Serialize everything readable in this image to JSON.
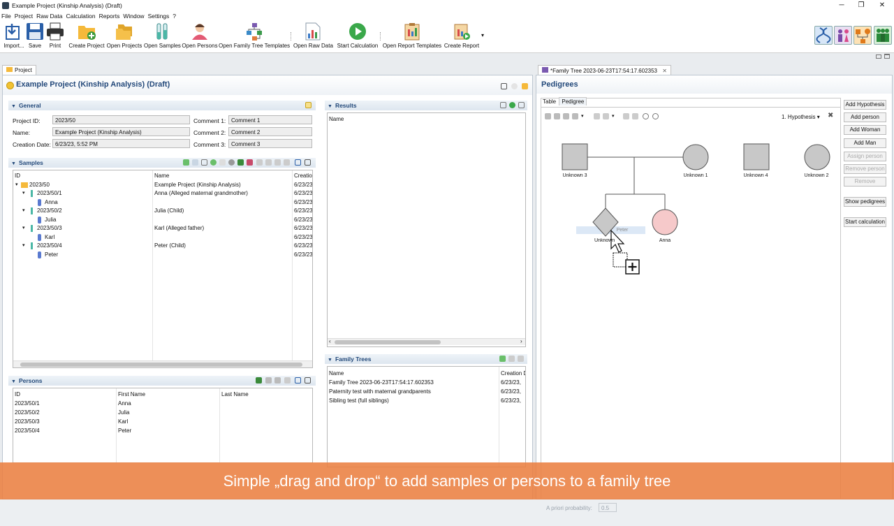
{
  "window": {
    "title": "Example Project (Kinship Analysis) (Draft)",
    "controls": [
      "─",
      "❐",
      "✕"
    ]
  },
  "menu": [
    "File",
    "Project",
    "Raw Data",
    "Calculation",
    "Reports",
    "Window",
    "Settings",
    "?"
  ],
  "toolbar": {
    "buttons": [
      {
        "label": "Import...",
        "icon": "import-icon"
      },
      {
        "label": "Save",
        "icon": "save-icon"
      },
      {
        "label": "Print",
        "icon": "print-icon"
      },
      {
        "label": "Create Project",
        "icon": "folder-add-icon"
      },
      {
        "label": "Open Projects",
        "icon": "folder-open-icon"
      },
      {
        "label": "Open Samples",
        "icon": "test-tubes-icon"
      },
      {
        "label": "Open Persons",
        "icon": "person-icon"
      },
      {
        "label": "Open Family Tree Templates",
        "icon": "family-tree-icon"
      },
      {
        "label": "Open Raw Data",
        "icon": "raw-data-icon"
      },
      {
        "label": "Start Calculation",
        "icon": "play-icon"
      },
      {
        "label": "Open Report Templates",
        "icon": "report-template-icon"
      },
      {
        "label": "Create Report",
        "icon": "report-create-icon"
      }
    ],
    "dropdown_glyph": "▾",
    "perspectives": [
      "dna-perspective-icon",
      "persons-perspective-icon",
      "pedigree-perspective-icon",
      "family-perspective-icon"
    ]
  },
  "left_tab": {
    "label": "Project"
  },
  "project_header": {
    "title": "Example Project (Kinship Analysis) (Draft)"
  },
  "general": {
    "title": "General",
    "project_id_label": "Project ID:",
    "project_id": "2023/50",
    "name_label": "Name:",
    "name": "Example Project (Kinship Analysis)",
    "creation_label": "Creation Date:",
    "creation": "6/23/23, 5:52 PM",
    "comment1_label": "Comment 1:",
    "comment1": "Comment 1",
    "comment2_label": "Comment 2:",
    "comment2": "Comment 2",
    "comment3_label": "Comment 3:",
    "comment3": "Comment 3"
  },
  "samples": {
    "title": "Samples",
    "columns": [
      "ID",
      "Name",
      "Creation"
    ],
    "rows": [
      {
        "id": "2023/50",
        "name": "Example Project (Kinship Analysis)",
        "date": "6/23/23"
      },
      {
        "id": "2023/50/1",
        "name": "Anna (Alleged maternal grandmother)",
        "date": "6/23/23"
      },
      {
        "id": "Anna",
        "name": "",
        "date": "6/23/23"
      },
      {
        "id": "2023/50/2",
        "name": "Julia (Child)",
        "date": "6/23/23"
      },
      {
        "id": "Julia",
        "name": "",
        "date": "6/23/23"
      },
      {
        "id": "2023/50/3",
        "name": "Karl (Alleged father)",
        "date": "6/23/23"
      },
      {
        "id": "Karl",
        "name": "",
        "date": "6/23/23"
      },
      {
        "id": "2023/50/4",
        "name": "Peter (Child)",
        "date": "6/23/23"
      },
      {
        "id": "Peter",
        "name": "",
        "date": "6/23/23"
      }
    ]
  },
  "persons": {
    "title": "Persons",
    "columns": [
      "ID",
      "First Name",
      "Last Name"
    ],
    "rows": [
      {
        "id": "2023/50/1",
        "first": "Anna",
        "last": ""
      },
      {
        "id": "2023/50/2",
        "first": "Julia",
        "last": ""
      },
      {
        "id": "2023/50/3",
        "first": "Karl",
        "last": ""
      },
      {
        "id": "2023/50/4",
        "first": "Peter",
        "last": ""
      }
    ]
  },
  "results": {
    "title": "Results",
    "column": "Name"
  },
  "family_trees": {
    "title": "Family Trees",
    "columns": [
      "Name",
      "Creation D"
    ],
    "rows": [
      {
        "name": "Family Tree 2023-06-23T17:54:17.602353",
        "date": "6/23/23,"
      },
      {
        "name": "Paternity test with maternal grandparents",
        "date": "6/23/23,"
      },
      {
        "name": "Sibling test (full siblings)",
        "date": "6/23/23,"
      }
    ]
  },
  "right_tab": {
    "label": "*Family Tree 2023-06-23T17:54:17.602353",
    "close": "✕"
  },
  "pedigrees": {
    "title": "Pedigrees",
    "subtabs": [
      "Table",
      "Pedigree"
    ],
    "hypothesis": "1. Hypothesis",
    "nodes": [
      {
        "label": "Unknown 3",
        "shape": "square"
      },
      {
        "label": "Unknown 1",
        "shape": "circle"
      },
      {
        "label": "Unknown 4",
        "shape": "square"
      },
      {
        "label": "Unknown 2",
        "shape": "circle"
      },
      {
        "label": "Unknown",
        "shape": "diamond"
      },
      {
        "label": "Anna",
        "shape": "circle"
      }
    ],
    "drag_label": "Peter",
    "buttons": [
      {
        "label": "Add Hypothesis",
        "enabled": true
      },
      {
        "label": "Add person",
        "enabled": true
      },
      {
        "label": "Add Woman",
        "enabled": true
      },
      {
        "label": "Add Man",
        "enabled": true
      },
      {
        "label": "Assign person",
        "enabled": false
      },
      {
        "label": "Remove person",
        "enabled": false
      },
      {
        "label": "Remove",
        "enabled": false
      },
      {
        "label": "Show pedigrees",
        "enabled": true
      },
      {
        "label": "Start calculation",
        "enabled": true
      }
    ],
    "apriori_label": "A priori probability:",
    "apriori_value": "0.5"
  },
  "banner": {
    "text": "Simple „drag and drop“ to add samples or persons to a family tree"
  },
  "colors": {
    "accent": "#23497a",
    "banner": "#ea8041",
    "female_node": "#f6c9ca",
    "node_gray": "#c8c8c8"
  }
}
